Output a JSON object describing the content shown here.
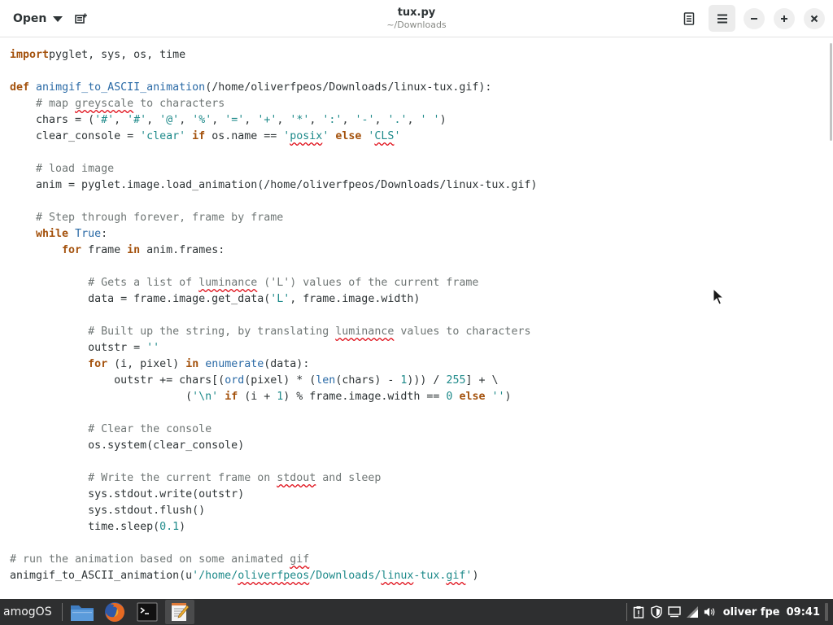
{
  "header": {
    "open_label": "Open",
    "title": "tux.py",
    "subtitle": "~/Downloads"
  },
  "editor": {
    "lines": [
      [
        [
          "k",
          "import"
        ],
        [
          "",
          "pyglet, sys, os, time"
        ]
      ],
      [],
      [
        [
          "k",
          "def"
        ],
        [
          "",
          " "
        ],
        [
          "f",
          "animgif_to_ASCII_animation"
        ],
        [
          "",
          "(/home/oliverfpeos/Downloads/linux-tux.gif):"
        ]
      ],
      [
        [
          "c",
          "    # map "
        ],
        [
          "c-sp",
          "greyscale"
        ],
        [
          "c",
          " to characters"
        ]
      ],
      [
        [
          "",
          "    chars = ("
        ],
        [
          "s",
          "'#'"
        ],
        [
          "",
          ", "
        ],
        [
          "s",
          "'#'"
        ],
        [
          "",
          ", "
        ],
        [
          "s",
          "'@'"
        ],
        [
          "",
          ", "
        ],
        [
          "s",
          "'%'"
        ],
        [
          "",
          ", "
        ],
        [
          "s",
          "'='"
        ],
        [
          "",
          ", "
        ],
        [
          "s",
          "'+'"
        ],
        [
          "",
          ", "
        ],
        [
          "s",
          "'*'"
        ],
        [
          "",
          ", "
        ],
        [
          "s",
          "':'"
        ],
        [
          "",
          ", "
        ],
        [
          "s",
          "'-'"
        ],
        [
          "",
          ", "
        ],
        [
          "s",
          "'.'"
        ],
        [
          "",
          ", "
        ],
        [
          "s",
          "' '"
        ],
        [
          "",
          ")"
        ]
      ],
      [
        [
          "",
          "    clear_console = "
        ],
        [
          "s",
          "'clear'"
        ],
        [
          "",
          " "
        ],
        [
          "k",
          "if"
        ],
        [
          "",
          " os.name == "
        ],
        [
          "s",
          "'"
        ],
        [
          "s-sp",
          "posix"
        ],
        [
          "s",
          "'"
        ],
        [
          "",
          " "
        ],
        [
          "k",
          "else"
        ],
        [
          "",
          " "
        ],
        [
          "s",
          "'"
        ],
        [
          "s-sp",
          "CLS"
        ],
        [
          "s",
          "'"
        ]
      ],
      [],
      [
        [
          "c",
          "    # load image"
        ]
      ],
      [
        [
          "",
          "    anim = pyglet.image.load_animation(/home/oliverfpeos/Downloads/linux-tux.gif)"
        ]
      ],
      [],
      [
        [
          "c",
          "    # Step through forever, frame by frame"
        ]
      ],
      [
        [
          "",
          "    "
        ],
        [
          "k",
          "while"
        ],
        [
          "",
          " "
        ],
        [
          "b",
          "True"
        ],
        [
          "",
          ":"
        ]
      ],
      [
        [
          "",
          "        "
        ],
        [
          "k",
          "for"
        ],
        [
          "",
          " frame "
        ],
        [
          "k",
          "in"
        ],
        [
          "",
          " anim.frames:"
        ]
      ],
      [],
      [
        [
          "c",
          "            # Gets a list of "
        ],
        [
          "c-sp",
          "luminance"
        ],
        [
          "c",
          " ('L') values of the current frame"
        ]
      ],
      [
        [
          "",
          "            data = frame.image.get_data("
        ],
        [
          "s",
          "'L'"
        ],
        [
          "",
          ", frame.image.width)"
        ]
      ],
      [],
      [
        [
          "c",
          "            # Built up the string, by translating "
        ],
        [
          "c-sp",
          "luminance"
        ],
        [
          "c",
          " values to characters"
        ]
      ],
      [
        [
          "",
          "            outstr = "
        ],
        [
          "s",
          "''"
        ]
      ],
      [
        [
          "",
          "            "
        ],
        [
          "k",
          "for"
        ],
        [
          "",
          " (i, pixel) "
        ],
        [
          "k",
          "in"
        ],
        [
          "",
          " "
        ],
        [
          "b",
          "enumerate"
        ],
        [
          "",
          "(data):"
        ]
      ],
      [
        [
          "",
          "                outstr += chars[("
        ],
        [
          "b",
          "ord"
        ],
        [
          "",
          "(pixel) * ("
        ],
        [
          "b",
          "len"
        ],
        [
          "",
          "(chars) - "
        ],
        [
          "n",
          "1"
        ],
        [
          "",
          "))) / "
        ],
        [
          "n",
          "255"
        ],
        [
          "",
          "] + \\"
        ]
      ],
      [
        [
          "",
          "                           ("
        ],
        [
          "s",
          "'\\n'"
        ],
        [
          "",
          " "
        ],
        [
          "k",
          "if"
        ],
        [
          "",
          " (i + "
        ],
        [
          "n",
          "1"
        ],
        [
          "",
          ") % frame.image.width == "
        ],
        [
          "n",
          "0"
        ],
        [
          "",
          " "
        ],
        [
          "k",
          "else"
        ],
        [
          "",
          " "
        ],
        [
          "s",
          "''"
        ],
        [
          "",
          ")"
        ]
      ],
      [],
      [
        [
          "c",
          "            # Clear the console"
        ]
      ],
      [
        [
          "",
          "            os.system(clear_console)"
        ]
      ],
      [],
      [
        [
          "c",
          "            # Write the current frame on "
        ],
        [
          "c-sp",
          "stdout"
        ],
        [
          "c",
          " and sleep"
        ]
      ],
      [
        [
          "",
          "            sys.stdout.write(outstr)"
        ]
      ],
      [
        [
          "",
          "            sys.stdout.flush()"
        ]
      ],
      [
        [
          "",
          "            time.sleep("
        ],
        [
          "n",
          "0.1"
        ],
        [
          "",
          ")"
        ]
      ],
      [],
      [
        [
          "c",
          "# run the animation based on some animated "
        ],
        [
          "c-sp",
          "gif"
        ]
      ],
      [
        [
          "",
          "animgif_to_ASCII_animation(u"
        ],
        [
          "s",
          "'/home/"
        ],
        [
          "s-sp",
          "oliverfpeos"
        ],
        [
          "s",
          "/Downloads/"
        ],
        [
          "s-sp",
          "linux"
        ],
        [
          "s",
          "-tux."
        ],
        [
          "s-sp",
          "gif"
        ],
        [
          "s",
          "'"
        ],
        [
          "",
          ")"
        ]
      ]
    ]
  },
  "taskbar": {
    "start_label": "amogOS",
    "apps": [
      {
        "name": "file-manager",
        "active": false
      },
      {
        "name": "firefox",
        "active": false
      },
      {
        "name": "terminal",
        "active": false
      },
      {
        "name": "text-editor",
        "active": true
      }
    ],
    "user": "oliver fpe",
    "clock": "09:41"
  }
}
